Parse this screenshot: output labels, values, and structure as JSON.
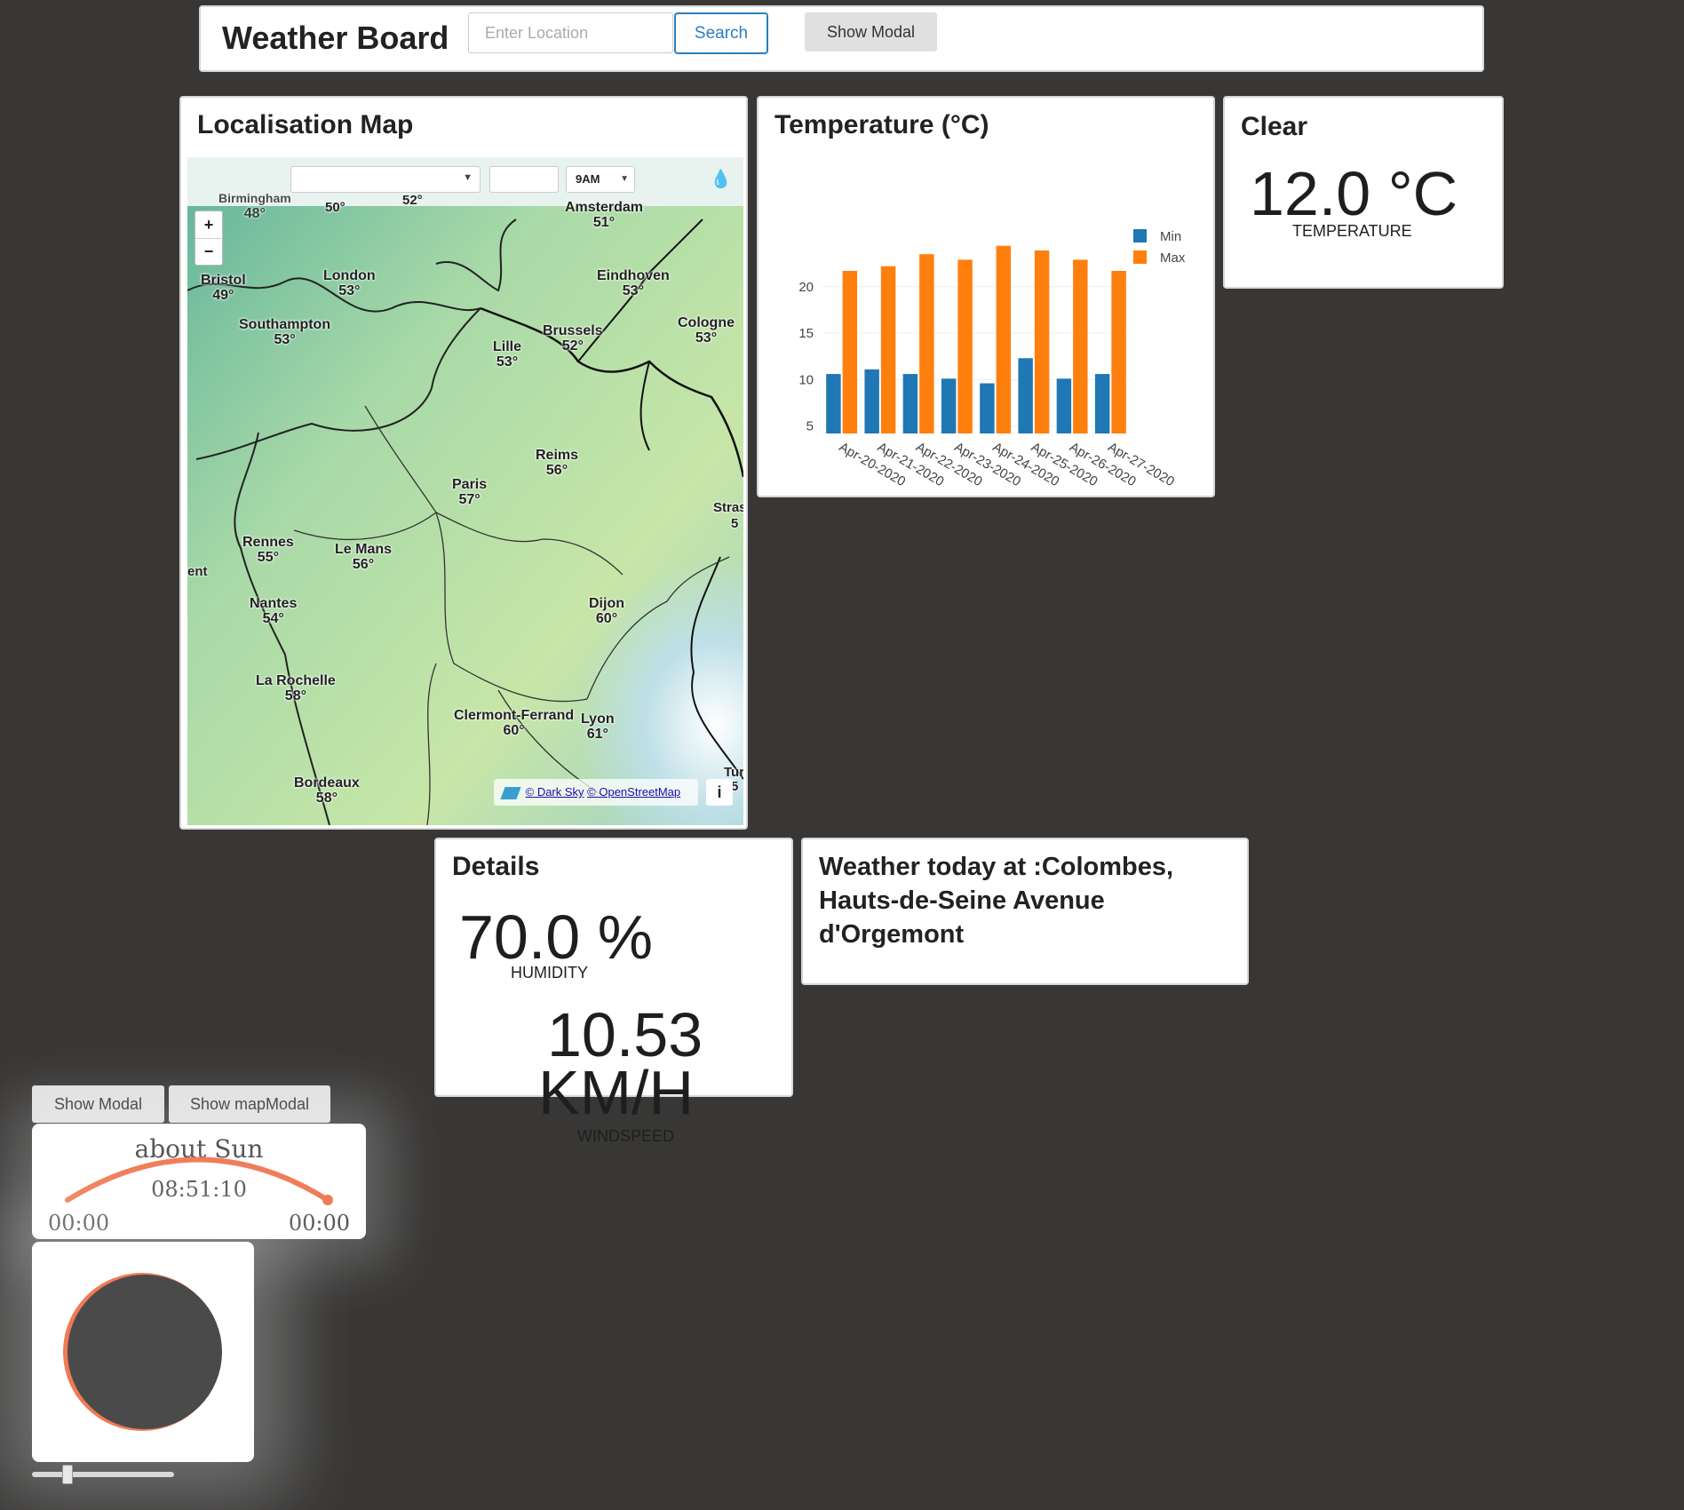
{
  "header": {
    "title": "Weather Board",
    "location_placeholder": "Enter Location",
    "search_label": "Search",
    "show_modal_label": "Show Modal"
  },
  "map": {
    "title": "Localisation Map",
    "time_select": "9AM",
    "attribution_darksky": "© Dark Sky",
    "attribution_osm": "© OpenStreetMap",
    "info_label": "i",
    "zoom_in": "+",
    "zoom_out": "−",
    "cities": [
      {
        "name": "Birmingham",
        "temp": "48°"
      },
      {
        "name": "Amsterdam",
        "temp": "51°"
      },
      {
        "name": "Bristol",
        "temp": "49°"
      },
      {
        "name": "London",
        "temp": "53°"
      },
      {
        "name": "Eindhoven",
        "temp": "53°"
      },
      {
        "name": "Southampton",
        "temp": "53°"
      },
      {
        "name": "Brussels",
        "temp": "52°"
      },
      {
        "name": "Cologne",
        "temp": "53°"
      },
      {
        "name": "Lille",
        "temp": "53°"
      },
      {
        "name": "Reims",
        "temp": "56°"
      },
      {
        "name": "Paris",
        "temp": "57°"
      },
      {
        "name": "Rennes",
        "temp": "55°"
      },
      {
        "name": "Le Mans",
        "temp": "56°"
      },
      {
        "name": "Nantes",
        "temp": "54°"
      },
      {
        "name": "Dijon",
        "temp": "60°"
      },
      {
        "name": "La Rochelle",
        "temp": "58°"
      },
      {
        "name": "Clermont-Ferrand",
        "temp": "60°"
      },
      {
        "name": "Lyon",
        "temp": "61°"
      },
      {
        "name": "Bordeaux",
        "temp": "58°"
      }
    ],
    "edge_labels": [
      "50°",
      "52°",
      "Stras",
      "5",
      "ent",
      "Tur",
      "5"
    ]
  },
  "temperature": {
    "title": "Temperature (°C)"
  },
  "chart_data": {
    "type": "bar",
    "categories": [
      "Apr-20-2020",
      "Apr-21-2020",
      "Apr-22-2020",
      "Apr-23-2020",
      "Apr-24-2020",
      "Apr-25-2020",
      "Apr-26-2020",
      "Apr-27-2020"
    ],
    "series": [
      {
        "name": "Min",
        "values": [
          10.6,
          11.1,
          10.6,
          10.1,
          9.6,
          12.3,
          10.1,
          10.6
        ],
        "color": "#1f77b4"
      },
      {
        "name": "Max",
        "values": [
          21.7,
          22.2,
          23.5,
          22.9,
          24.4,
          23.9,
          22.9,
          21.7
        ],
        "color": "#ff7f0e"
      }
    ],
    "yticks": [
      5,
      10,
      15,
      20
    ],
    "ylim": [
      4.2,
      26
    ],
    "legend": "top-right",
    "grid": true
  },
  "current": {
    "condition": "Clear",
    "temperature": "12.0 °C",
    "temperature_caption": "TEMPERATURE"
  },
  "details": {
    "title": "Details",
    "humidity": "70.0 %",
    "humidity_caption": "HUMIDITY",
    "windspeed_value": "10.53",
    "windspeed_unit": "KM/H",
    "windspeed_caption": "WINDSPEED"
  },
  "location": {
    "text": "Weather today at :Colombes, Hauts-de-Seine Avenue d'Orgemont"
  },
  "bottom_buttons": {
    "show_modal": "Show Modal",
    "show_map_modal": "Show mapModal"
  },
  "sun": {
    "title": "about Sun",
    "time": "08:51:10",
    "sunrise": "00:00",
    "sunset": "00:00",
    "arc_color": "#f07a55",
    "progress": 1.0
  },
  "moon": {
    "disc_color": "#4a4a4a",
    "rim_color": "#f07a55",
    "slider_value": 0.25
  }
}
